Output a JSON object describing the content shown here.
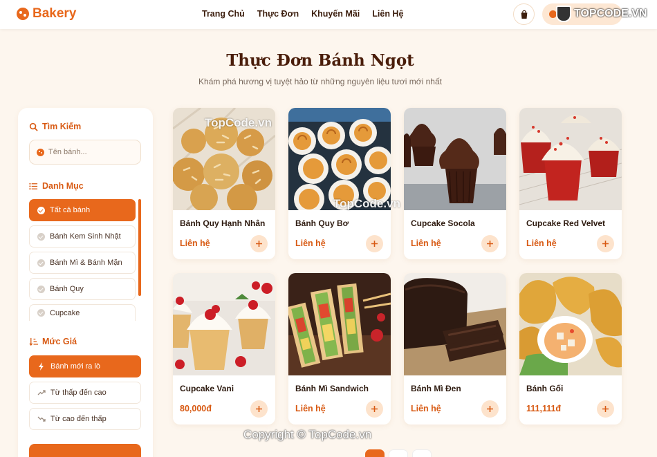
{
  "header": {
    "logo_text": "Bakery",
    "nav": [
      "Trang Chủ",
      "Thực Đơn",
      "Khuyến Mãi",
      "Liên Hệ"
    ],
    "login_label": "Đăng nhập",
    "watermark_brand": "TOPCODE.VN"
  },
  "page": {
    "title": "Thực Đơn Bánh Ngọt",
    "subtitle": "Khám phá hương vị tuyệt hảo từ những nguyên liệu tươi mới nhất"
  },
  "sidebar": {
    "search_title": "Tìm Kiếm",
    "search_placeholder": "Tên bánh...",
    "category_title": "Danh Mục",
    "categories": [
      {
        "label": "Tất cả bánh",
        "active": true
      },
      {
        "label": "Bánh Kem Sinh Nhật",
        "active": false
      },
      {
        "label": "Bánh Mì & Bánh Mặn",
        "active": false
      },
      {
        "label": "Bánh Quy",
        "active": false
      },
      {
        "label": "Cupcake",
        "active": false
      }
    ],
    "price_title": "Mức Giá",
    "price_options": [
      {
        "label": "Bánh mới ra lò",
        "active": true
      },
      {
        "label": "Từ thấp đến cao",
        "active": false
      },
      {
        "label": "Từ cao đến thấp",
        "active": false
      }
    ]
  },
  "products": [
    {
      "name": "Bánh Quy Hạnh Nhân",
      "price": "Liên hệ"
    },
    {
      "name": "Bánh Quy Bơ",
      "price": "Liên hệ"
    },
    {
      "name": "Cupcake Socola",
      "price": "Liên hệ"
    },
    {
      "name": "Cupcake Red Velvet",
      "price": "Liên hệ"
    },
    {
      "name": "Cupcake Vani",
      "price": "80,000đ"
    },
    {
      "name": "Bánh Mì Sandwich",
      "price": "Liên hệ"
    },
    {
      "name": "Bánh Mì Đen",
      "price": "Liên hệ"
    },
    {
      "name": "Bánh Gối",
      "price": "111,111đ"
    }
  ],
  "watermarks": {
    "topcode_1": "TopCode.vn",
    "topcode_2": "TopCode.vn",
    "copyright": "Copyright © TopCode.vn"
  },
  "colors": {
    "accent": "#e8681c",
    "background": "#fdf6ee",
    "title": "#4a1d0a"
  }
}
